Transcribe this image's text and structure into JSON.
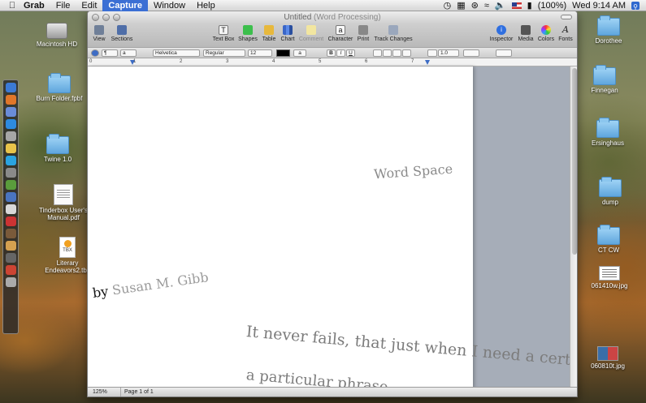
{
  "menubar": {
    "apple": "",
    "menus": [
      "Grab",
      "File",
      "Edit",
      "Capture",
      "Window",
      "Help"
    ],
    "active_menu": "Capture",
    "battery": "(100%)",
    "clock": "Wed 9:14 AM"
  },
  "desktop_left": [
    {
      "label": "Macintosh HD",
      "icon": "hard-drive-icon"
    },
    {
      "label": "Burn Folder.fpbf",
      "icon": "burn-folder-icon"
    },
    {
      "label": "Twine 1.0",
      "icon": "folder-icon"
    },
    {
      "label": "Tinderbox User's Manual.pdf",
      "icon": "pdf-icon"
    },
    {
      "label": "Literary Endeavors2.tbx",
      "icon": "tbx-icon",
      "badge": "TBX"
    }
  ],
  "desktop_right": [
    {
      "label": "Dorothee",
      "icon": "folder-icon"
    },
    {
      "label": "Finnegan",
      "icon": "folder-icon"
    },
    {
      "label": "Ersinghaus",
      "icon": "folder-icon"
    },
    {
      "label": "dump",
      "icon": "folder-icon"
    },
    {
      "label": "CT CW",
      "icon": "folder-icon"
    },
    {
      "label": "061410w.jpg",
      "icon": "image-file-icon"
    },
    {
      "label": "060810t.jpg",
      "icon": "image-file-icon"
    }
  ],
  "window": {
    "title": "Untitled",
    "title_suffix": "(Word Processing)"
  },
  "toolbar": {
    "view": "View",
    "sections": "Sections",
    "text_box": "Text Box",
    "shapes": "Shapes",
    "table": "Table",
    "chart": "Chart",
    "comment": "Comment",
    "character": "Character",
    "print": "Print",
    "track_changes": "Track Changes",
    "inspector": "Inspector",
    "media": "Media",
    "colors": "Colors",
    "fonts": "Fonts"
  },
  "format_bar": {
    "paragraph_style": "¶",
    "char_style": "a",
    "font_family": "Helvetica",
    "font_style": "Regular",
    "font_size": "12",
    "highlight": "a",
    "bold": "B",
    "italic": "I",
    "underline": "U",
    "line_spacing": "1.0"
  },
  "ruler": {
    "numbers": [
      "0",
      "1",
      "2",
      "3",
      "4",
      "5",
      "6",
      "7"
    ]
  },
  "document": {
    "word_space": "Word Space",
    "byline_by": "by ",
    "byline_name": "Susan M. Gibb",
    "line1": "It never fails, that just when I need a certain word,",
    "line2": "a particular phrase,"
  },
  "status": {
    "zoom": "125%",
    "page": "Page 1 of 1"
  },
  "colors": {
    "accent": "#3b6fd4",
    "page_text_grey": "#8a8a8a"
  }
}
